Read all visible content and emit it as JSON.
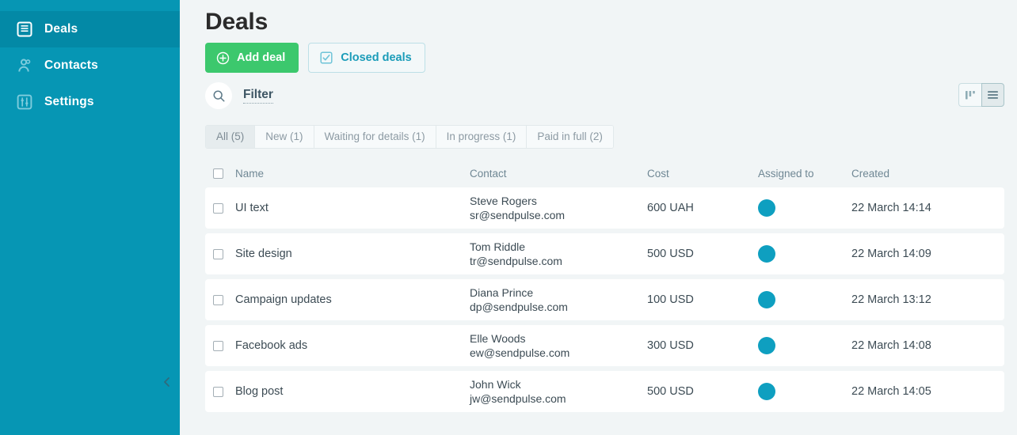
{
  "sidebar": {
    "items": [
      {
        "label": "Deals",
        "icon": "document-list-icon",
        "active": true
      },
      {
        "label": "Contacts",
        "icon": "contacts-user-icon",
        "active": false
      },
      {
        "label": "Settings",
        "icon": "sliders-settings-icon",
        "active": false
      }
    ],
    "collapse_icon": "chevron-left-icon"
  },
  "header": {
    "title": "Deals",
    "add_deal_label": "Add deal",
    "add_deal_icon": "plus-circle-icon",
    "closed_deals_label": "Closed deals",
    "closed_deals_icon": "checkbox-checked-icon"
  },
  "filter": {
    "search_icon": "search-icon",
    "label": "Filter"
  },
  "view_toggle": {
    "kanban_icon": "columns-view-icon",
    "list_icon": "list-view-icon",
    "active": "list"
  },
  "tabs": [
    {
      "label": "All (5)",
      "active": true
    },
    {
      "label": "New (1)",
      "active": false
    },
    {
      "label": "Waiting for details (1)",
      "active": false
    },
    {
      "label": "In progress (1)",
      "active": false
    },
    {
      "label": "Paid in full (2)",
      "active": false
    }
  ],
  "table": {
    "columns": [
      "Name",
      "Contact",
      "Cost",
      "Assigned to",
      "Created"
    ],
    "rows": [
      {
        "name": "UI text",
        "contact_name": "Steve Rogers",
        "contact_email": "sr@sendpulse.com",
        "cost": "600 UAH",
        "assigned_avatar_color": "#0e9fc0",
        "created": "22 March 14:14"
      },
      {
        "name": "Site design",
        "contact_name": "Tom Riddle",
        "contact_email": "tr@sendpulse.com",
        "cost": "500 USD",
        "assigned_avatar_color": "#0e9fc0",
        "created": "22 March 14:09"
      },
      {
        "name": "Campaign updates",
        "contact_name": "Diana Prince",
        "contact_email": "dp@sendpulse.com",
        "cost": "100 USD",
        "assigned_avatar_color": "#0e9fc0",
        "created": "22 March 13:12"
      },
      {
        "name": "Facebook ads",
        "contact_name": "Elle Woods",
        "contact_email": "ew@sendpulse.com",
        "cost": "300 USD",
        "assigned_avatar_color": "#0e9fc0",
        "created": "22 March 14:08"
      },
      {
        "name": "Blog post",
        "contact_name": "John Wick",
        "contact_email": "jw@sendpulse.com",
        "cost": "500 USD",
        "assigned_avatar_color": "#0e9fc0",
        "created": "22 March 14:05"
      }
    ]
  },
  "colors": {
    "sidebar_bg": "#0696b4",
    "sidebar_active_bg": "#0389a6",
    "page_bg": "#f1f5f6",
    "accent_green": "#3cc86d",
    "accent_teal": "#1b9cb9",
    "avatar_teal": "#0e9fc0"
  }
}
